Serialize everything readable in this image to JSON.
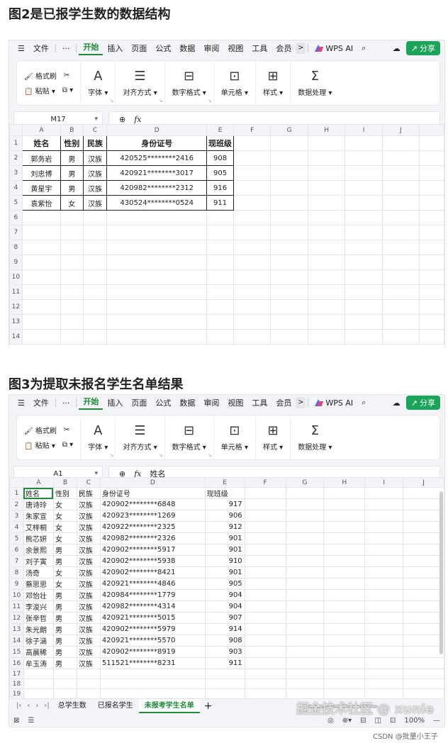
{
  "headings": {
    "fig2": "图2是已报学生数的数据结构",
    "fig3": "图3为提取未报名学生名单结果"
  },
  "menu": {
    "file": "文件",
    "more": "···",
    "tabs": [
      "开始",
      "插入",
      "页面",
      "公式",
      "数据",
      "审阅",
      "视图",
      "工具",
      "会员"
    ],
    "active": "开始",
    "chev": ">",
    "ai": "WPS AI",
    "share": "分享"
  },
  "ribbon": {
    "format_painter": "格式刷",
    "paste": "粘贴",
    "font": "字体",
    "align": "对齐方式",
    "numfmt": "数字格式",
    "cell": "单元格",
    "style": "样式",
    "dataproc": "数据处理"
  },
  "win1": {
    "cellref": "M17",
    "formula": "",
    "cols": [
      "A",
      "B",
      "C",
      "D",
      "E",
      "F",
      "G",
      "H",
      "I",
      "J"
    ],
    "rows": [
      [
        "姓名",
        "性别",
        "民族",
        "身份证号",
        "现班级"
      ],
      [
        "郭务岩",
        "男",
        "汉族",
        "420525********2416",
        "908"
      ],
      [
        "刘忠博",
        "男",
        "汉族",
        "420921********3017",
        "905"
      ],
      [
        "黄星宇",
        "男",
        "汉族",
        "420982********2312",
        "916"
      ],
      [
        "袁紫怡",
        "女",
        "汉族",
        "430524********0524",
        "911"
      ]
    ],
    "row_numbers": [
      "1",
      "2",
      "3",
      "4",
      "5",
      "6",
      "7",
      "8",
      "9",
      "10",
      "11",
      "12",
      "13",
      "14"
    ]
  },
  "win2": {
    "cellref": "A1",
    "formula": "姓名",
    "cols": [
      "A",
      "B",
      "C",
      "D",
      "E",
      "F",
      "G",
      "H",
      "I",
      "J"
    ],
    "rows": [
      [
        "姓名",
        "性别",
        "民族",
        "身份证号",
        "现班级"
      ],
      [
        "唐诗玲",
        "女",
        "汉族",
        "420902********6848",
        "917"
      ],
      [
        "朱家宣",
        "女",
        "汉族",
        "420923********1269",
        "906"
      ],
      [
        "艾梓桐",
        "女",
        "汉族",
        "420922********2325",
        "912"
      ],
      [
        "熊芯妍",
        "女",
        "汉族",
        "420982********2326",
        "901"
      ],
      [
        "余景熙",
        "男",
        "汉族",
        "420902********5917",
        "901"
      ],
      [
        "刘子寅",
        "男",
        "汉族",
        "420902********5938",
        "910"
      ],
      [
        "汤奇",
        "女",
        "汉族",
        "420902********8421",
        "901"
      ],
      [
        "蔡思思",
        "女",
        "汉族",
        "420921********4846",
        "905"
      ],
      [
        "邓怡壮",
        "男",
        "汉族",
        "420984********1779",
        "904"
      ],
      [
        "李浚兴",
        "男",
        "汉族",
        "420982********4314",
        "904"
      ],
      [
        "张辛哲",
        "男",
        "汉族",
        "420921********5015",
        "907"
      ],
      [
        "朱光朗",
        "男",
        "汉族",
        "420902********5979",
        "914"
      ],
      [
        "徐子涵",
        "男",
        "汉族",
        "420921********5570",
        "908"
      ],
      [
        "高晨稀",
        "男",
        "汉族",
        "420902********8919",
        "903"
      ],
      [
        "牟玉涛",
        "男",
        "汉族",
        "511521********8231",
        "911"
      ]
    ],
    "row_numbers": [
      "1",
      "2",
      "3",
      "4",
      "5",
      "6",
      "7",
      "8",
      "9",
      "10",
      "11",
      "12",
      "13",
      "14",
      "15",
      "16",
      "17",
      "18",
      "19",
      "20",
      "21",
      "22"
    ],
    "sheets": [
      "总学生数",
      "已报名学生",
      "未报考学生名单"
    ],
    "active_sheet": "未报考学生名单",
    "zoom": "100%"
  },
  "watermark": {
    "site": "掘金技术社区 @ xunle",
    "csdn": "CSDN @批量小王子"
  },
  "colors": {
    "accent": "#1e8a3a",
    "share": "#19a45a"
  }
}
